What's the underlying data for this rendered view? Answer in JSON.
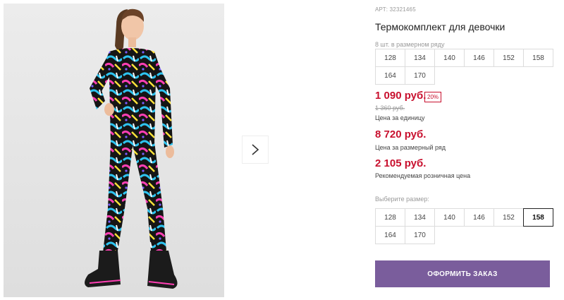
{
  "product": {
    "article": "АРТ: 32321465",
    "title": "Термокомплект для девочки",
    "pack_note": "8 шт. в размерном ряду",
    "pack_sizes": [
      "128",
      "134",
      "140",
      "146",
      "152",
      "158",
      "164",
      "170"
    ]
  },
  "prices": {
    "unit_price": "1 090 руб.",
    "discount": "20%",
    "old_price": "1 360 руб.",
    "unit_caption": "Цена за единицу",
    "set_price": "8 720 руб.",
    "set_caption": "Цена за размерный ряд",
    "retail_price": "2 105 руб.",
    "retail_caption": "Рекомендуемая розничная цена"
  },
  "size_select": {
    "label": "Выберите размер:",
    "sizes": [
      "128",
      "134",
      "140",
      "146",
      "152",
      "158",
      "164",
      "170"
    ],
    "selected": "158"
  },
  "actions": {
    "order_label": "ОФОРМИТЬ ЗАКАЗ"
  },
  "icons": {
    "next": "chevron-right-icon"
  },
  "colors": {
    "accent": "#7a5d9c",
    "price": "#c8102e"
  }
}
